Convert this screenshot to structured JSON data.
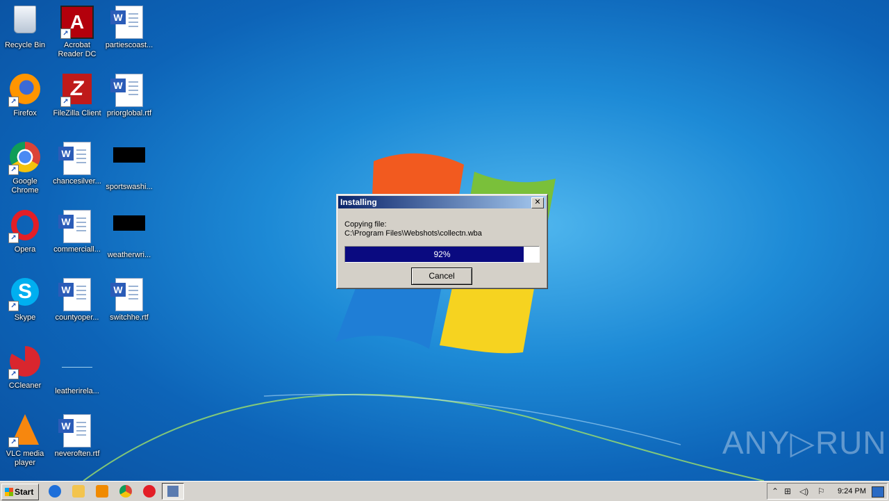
{
  "desktop": {
    "icons": [
      {
        "label": "Recycle Bin"
      },
      {
        "label": "Acrobat Reader DC"
      },
      {
        "label": "partiescoast..."
      },
      {
        "label": "Firefox"
      },
      {
        "label": "FileZilla Client"
      },
      {
        "label": "priorglobal.rtf"
      },
      {
        "label": "Google Chrome"
      },
      {
        "label": "chancesilver..."
      },
      {
        "label": "sportswashi..."
      },
      {
        "label": "Opera"
      },
      {
        "label": "commerciall..."
      },
      {
        "label": "weatherwri..."
      },
      {
        "label": "Skype"
      },
      {
        "label": "countyoper..."
      },
      {
        "label": "switchhe.rtf"
      },
      {
        "label": "CCleaner"
      },
      {
        "label": "leatherirela..."
      },
      {
        "label": "VLC media player"
      },
      {
        "label": "neveroften.rtf"
      }
    ],
    "shortcut_glyph": "↗"
  },
  "dialog": {
    "title": "Installing",
    "close_glyph": "✕",
    "message_line1": "Copying file:",
    "message_line2": "C:\\Program Files\\Webshots\\collectn.wba",
    "progress_percent": 92,
    "progress_label": "92%",
    "cancel_label": "Cancel"
  },
  "watermark": "ANY▷RUN",
  "taskbar": {
    "start_label": "Start",
    "clock": "9:24 PM",
    "tray_icons": [
      "chevron-up-icon",
      "network-icon",
      "volume-icon",
      "flag-icon"
    ],
    "tray_glyphs": {
      "chevron": "⌃",
      "network": "⊞",
      "volume": "◁)",
      "flag": "⚐"
    }
  },
  "colors": {
    "progress_fill": "#0a0a80",
    "titlebar_start": "#0a246a",
    "titlebar_end": "#a6caf0",
    "dialog_face": "#d4d0c8"
  }
}
